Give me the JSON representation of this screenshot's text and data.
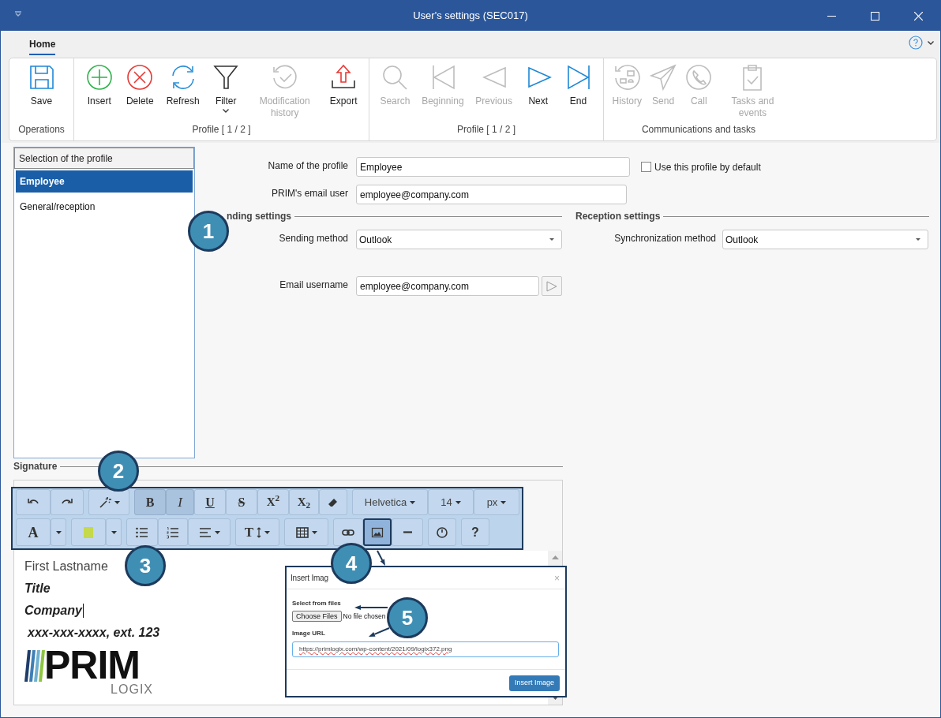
{
  "window": {
    "title": "User's settings (SEC017)"
  },
  "tabs": [
    {
      "label": "Home",
      "selected": true
    }
  ],
  "ribbon": {
    "groups": [
      {
        "label": "Operations",
        "buttons": [
          {
            "kind": "save",
            "label": "Save",
            "disabled": false
          }
        ]
      },
      {
        "label": "Profile [ 1 / 2 ]",
        "buttons": [
          {
            "kind": "insert",
            "label": "Insert",
            "disabled": false
          },
          {
            "kind": "delete",
            "label": "Delete",
            "disabled": false
          },
          {
            "kind": "refresh",
            "label": "Refresh",
            "disabled": false
          },
          {
            "kind": "filter",
            "label": "Filter",
            "disabled": false
          },
          {
            "kind": "modhistory",
            "label": "Modification history",
            "disabled": true
          },
          {
            "kind": "export",
            "label": "Export",
            "disabled": false
          }
        ]
      },
      {
        "label": "Profile [ 1 / 2 ]",
        "buttons": [
          {
            "kind": "search",
            "label": "Search",
            "disabled": true
          },
          {
            "kind": "first",
            "label": "Beginning",
            "disabled": true
          },
          {
            "kind": "previous",
            "label": "Previous",
            "disabled": true
          },
          {
            "kind": "next",
            "label": "Next",
            "disabled": false
          },
          {
            "kind": "last",
            "label": "End",
            "disabled": false
          }
        ]
      },
      {
        "label": "Communications and tasks",
        "buttons": [
          {
            "kind": "commhistory",
            "label": "History",
            "disabled": true
          },
          {
            "kind": "send",
            "label": "Send",
            "disabled": true
          },
          {
            "kind": "call",
            "label": "Call",
            "disabled": true
          },
          {
            "kind": "tasks",
            "label": "Tasks and events",
            "disabled": true
          }
        ]
      }
    ]
  },
  "profiles": {
    "header": "Selection of the profile",
    "items": [
      {
        "label": "Employee",
        "selected": true
      },
      {
        "label": "General/reception",
        "selected": false
      }
    ]
  },
  "form": {
    "name_label": "Name of the profile",
    "name_value": "Employee",
    "default_checkbox": {
      "label": "Use this profile by default",
      "checked": false
    },
    "email_user_label": "PRIM's email user",
    "email_user_value": "employee@company.com",
    "sending_title": "nding settings",
    "reception_title": "Reception settings",
    "sending_method_label": "Sending method",
    "sending_method_value": "Outlook",
    "sync_method_label": "Synchronization method",
    "sync_method_value": "Outlook",
    "email_username_label": "Email username",
    "email_username_value": "employee@company.com"
  },
  "signature": {
    "title": "Signature",
    "toolbar": [
      [
        {
          "buttons": [
            {
              "kind": "undo"
            },
            {
              "kind": "redo"
            }
          ]
        },
        {
          "buttons": [
            {
              "kind": "magic"
            }
          ]
        },
        {
          "buttons": [
            {
              "kind": "bold",
              "text": "B",
              "on": true
            },
            {
              "kind": "italic",
              "text": "I",
              "on": true
            },
            {
              "kind": "underline",
              "text": "U",
              "on": false
            },
            {
              "kind": "strike",
              "text": "S",
              "on": false
            },
            {
              "kind": "sup",
              "text": "X$^{2}$",
              "on": false
            },
            {
              "kind": "sub",
              "text": "X$_{2}$",
              "on": false
            },
            {
              "kind": "eraser",
              "on": false
            }
          ]
        },
        {
          "buttons": [
            {
              "kind": "font",
              "text": "Helvetica"
            },
            {
              "kind": "size",
              "text": "14"
            },
            {
              "kind": "unit",
              "text": "px"
            }
          ]
        }
      ],
      [
        {
          "buttons": [
            {
              "kind": "fontcolor",
              "text": "A"
            },
            {
              "kind": "caret"
            }
          ]
        },
        {
          "buttons": [
            {
              "kind": "highlight"
            },
            {
              "kind": "caret"
            }
          ]
        },
        {
          "buttons": [
            {
              "kind": "ul"
            },
            {
              "kind": "ol"
            },
            {
              "kind": "align"
            }
          ]
        },
        {
          "buttons": [
            {
              "kind": "textheight",
              "text": "T"
            }
          ]
        },
        {
          "buttons": [
            {
              "kind": "table"
            }
          ]
        },
        {
          "buttons": [
            {
              "kind": "link",
              "on": false
            },
            {
              "kind": "image",
              "on": true
            },
            {
              "kind": "hr",
              "on": false
            }
          ]
        },
        {
          "buttons": [
            {
              "kind": "clock"
            }
          ]
        },
        {
          "buttons": [
            {
              "kind": "help",
              "text": "?"
            }
          ]
        }
      ]
    ],
    "lines": [
      {
        "kind": "plain",
        "text": "First Lastname",
        "cursor": false
      },
      {
        "kind": "bold-italic",
        "text": "Title",
        "cursor": false
      },
      {
        "kind": "bold-italic",
        "text": "Company",
        "cursor": true
      },
      {
        "kind": "bold-italic",
        "text": "xxx-xxx-xxxx, ext. 123",
        "cursor": false
      }
    ],
    "logo": {
      "word": "PRIM",
      "subword": "LOGIX"
    }
  },
  "dialog": {
    "title": "Insert Imag",
    "close": "×",
    "files_label": "Select from files",
    "choose_button": "Choose Files",
    "file_status": "No file chosen",
    "url_label": "Image URL",
    "url_value": "https://primlogix.com/wp-content/2021/09/logix372.png",
    "insert_button": "Insert Image"
  },
  "callouts": [
    {
      "number": "1"
    },
    {
      "number": "2"
    },
    {
      "number": "3"
    },
    {
      "number": "4"
    },
    {
      "number": "5"
    }
  ]
}
